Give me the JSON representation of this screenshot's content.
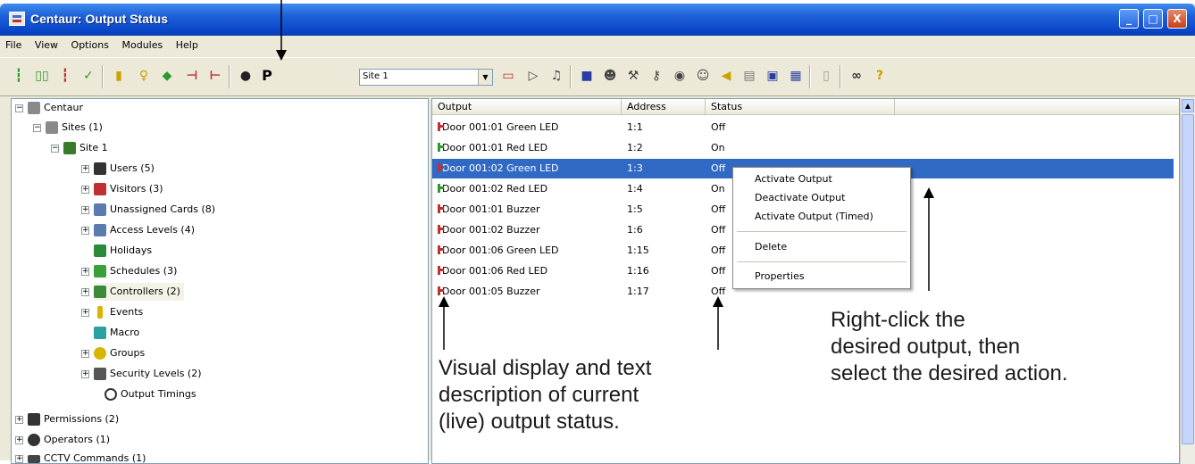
{
  "window": {
    "title": "Centaur: Output Status",
    "controls": [
      "_",
      "□",
      "X"
    ]
  },
  "menubar": [
    "File",
    "View",
    "Options",
    "Modules",
    "Help"
  ],
  "toolbar": {
    "site_selector": "Site 1",
    "p_label": "P",
    "icons": [
      "input-icon",
      "doors-icon",
      "output-icon",
      "check-icon",
      "door-icon",
      "bulb-icon",
      "card-icon",
      "relay-icon",
      "output-active-icon",
      "user-icon",
      "p-icon",
      "rect-icon",
      "tag-icon",
      "network-icon",
      "reader-icon",
      "visitor-icon",
      "tools-icon",
      "keys-icon",
      "camera-icon",
      "person-icon",
      "speaker-icon",
      "printer-icon",
      "monitor-icon",
      "graph-icon",
      "document-icon",
      "binoculars-icon",
      "help-icon"
    ]
  },
  "tree": {
    "root": "Centaur",
    "items": [
      {
        "label": "Sites (1)"
      },
      {
        "label": "Site 1"
      },
      {
        "label": "Users (5)"
      },
      {
        "label": "Visitors (3)"
      },
      {
        "label": "Unassigned Cards (8)"
      },
      {
        "label": "Access Levels (4)"
      },
      {
        "label": "Holidays"
      },
      {
        "label": "Schedules (3)"
      },
      {
        "label": "Controllers (2)"
      },
      {
        "label": "Events"
      },
      {
        "label": "Macro"
      },
      {
        "label": "Groups"
      },
      {
        "label": "Security Levels (2)"
      },
      {
        "label": "Output Timings"
      },
      {
        "label": "Permissions (2)"
      },
      {
        "label": "Operators (1)"
      },
      {
        "label": "CCTV Commands (1)"
      }
    ]
  },
  "list": {
    "columns": [
      "Output",
      "Address",
      "Status"
    ],
    "rows": [
      {
        "output": "Door 001:01 Green LED",
        "address": "1:1",
        "status": "Off",
        "color": "#c03030"
      },
      {
        "output": "Door 001:01 Red LED",
        "address": "1:2",
        "status": "On",
        "color": "#2a9a2a"
      },
      {
        "output": "Door 001:02 Green LED",
        "address": "1:3",
        "status": "Off",
        "color": "#c03030"
      },
      {
        "output": "Door 001:02 Red LED",
        "address": "1:4",
        "status": "On",
        "color": "#2a9a2a"
      },
      {
        "output": "Door 001:01 Buzzer",
        "address": "1:5",
        "status": "Off",
        "color": "#c03030"
      },
      {
        "output": "Door 001:02 Buzzer",
        "address": "1:6",
        "status": "Off",
        "color": "#c03030"
      },
      {
        "output": "Door 001:06 Green LED",
        "address": "1:15",
        "status": "Off",
        "color": "#c03030"
      },
      {
        "output": "Door 001:06 Red LED",
        "address": "1:16",
        "status": "Off",
        "color": "#c03030"
      },
      {
        "output": "Door 001:05 Buzzer",
        "address": "1:17",
        "status": "Off",
        "color": "#c03030"
      }
    ]
  },
  "context_menu": {
    "activate": "Activate Output",
    "deactivate": "Deactivate Output",
    "activate_timed": "Activate Output (Timed)",
    "delete": "Delete",
    "properties": "Properties"
  },
  "annotations": {
    "left": [
      "Visual display and text",
      "description of current",
      "(live) output status."
    ],
    "right": [
      "Right-click the",
      "desired output, then",
      "select the desired action."
    ]
  }
}
